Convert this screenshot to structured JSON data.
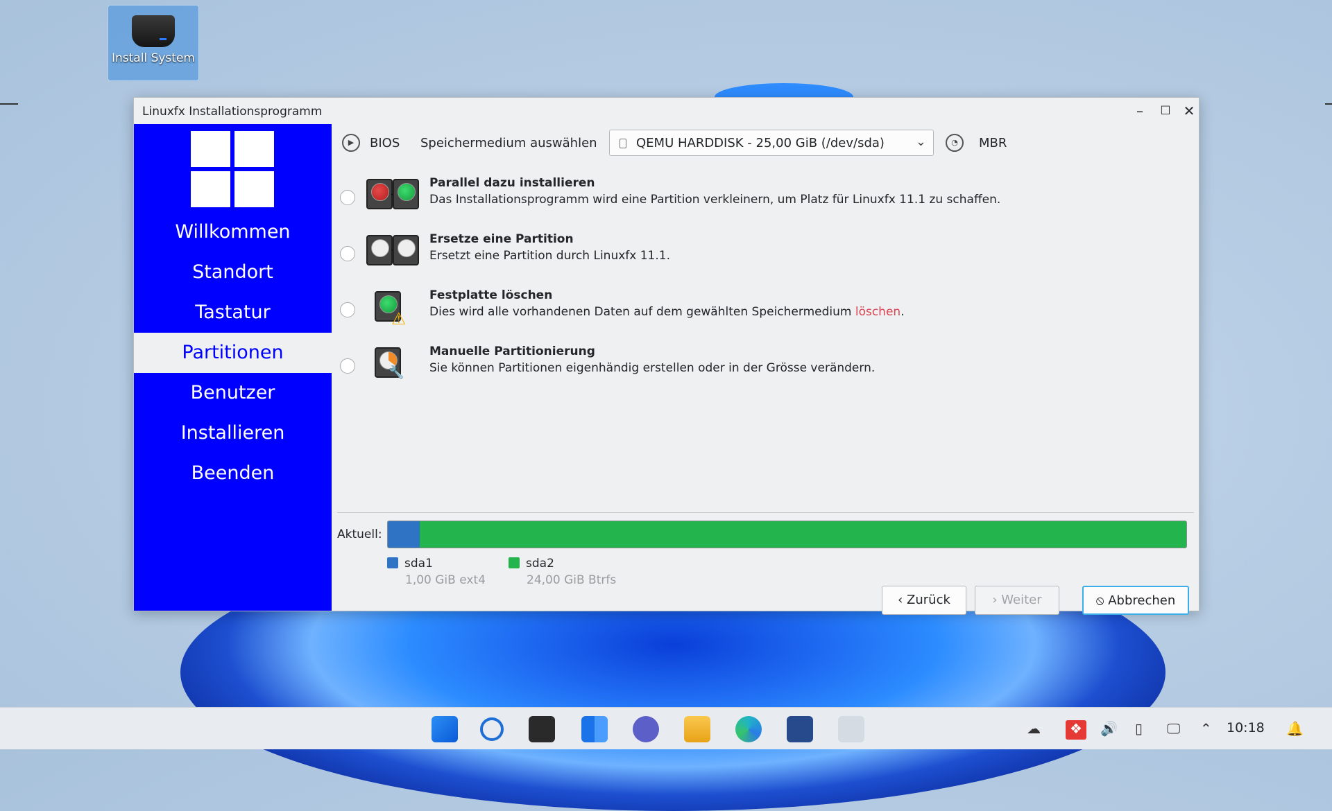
{
  "desktop": {
    "icon_label": "Install System"
  },
  "window": {
    "title": "Linuxfx Installationsprogramm",
    "controls": {
      "minimize": "–",
      "maximize": "☐",
      "close": "✕"
    }
  },
  "sidebar": {
    "items": [
      {
        "label": "Willkommen",
        "active": false
      },
      {
        "label": "Standort",
        "active": false
      },
      {
        "label": "Tastatur",
        "active": false
      },
      {
        "label": "Partitionen",
        "active": true
      },
      {
        "label": "Benutzer",
        "active": false
      },
      {
        "label": "Installieren",
        "active": false
      },
      {
        "label": "Beenden",
        "active": false
      }
    ]
  },
  "toprow": {
    "firmware": "BIOS",
    "select_label": "Speichermedium auswählen",
    "disk_value": "QEMU HARDDISK - 25,00 GiB (/dev/sda)",
    "table_type": "MBR"
  },
  "options": [
    {
      "title": "Parallel dazu installieren",
      "desc": "Das Installationsprogramm wird eine Partition verkleinern, um Platz für Linuxfx 11.1 zu schaffen."
    },
    {
      "title": "Ersetze eine Partition",
      "desc": "Ersetzt eine Partition durch Linuxfx 11.1."
    },
    {
      "title": "Festplatte löschen",
      "desc_before": "Dies wird alle vorhandenen Daten auf dem gewählten Speichermedium ",
      "desc_danger": "löschen",
      "desc_after": "."
    },
    {
      "title": "Manuelle Partitionierung",
      "desc": "Sie können Partitionen eigenhändig erstellen oder in der Grösse verändern."
    }
  ],
  "partitions": {
    "label": "Aktuell:",
    "items": [
      {
        "name": "sda1",
        "detail": "1,00 GiB ext4",
        "color": "#2f73c4",
        "fraction": 0.04
      },
      {
        "name": "sda2",
        "detail": "24,00 GiB Btrfs",
        "color": "#24b44e",
        "fraction": 0.96
      }
    ]
  },
  "buttons": {
    "back": "Zurück",
    "next": "Weiter",
    "cancel": "Abbrechen"
  },
  "taskbar": {
    "clock": "10:18"
  },
  "colors": {
    "sidebar": "#0000ff",
    "accent": "#3daee9",
    "danger": "#da4453"
  }
}
